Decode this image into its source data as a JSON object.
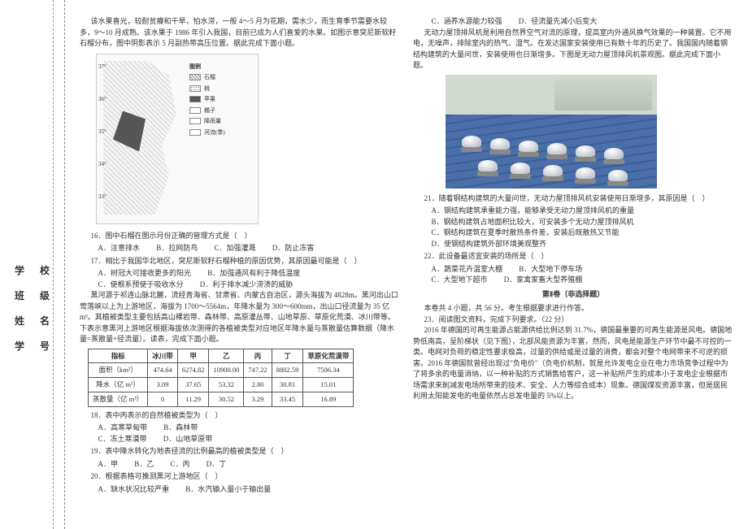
{
  "sidebar": {
    "labels": [
      "学 校",
      "班 级",
      "姓 名",
      "学 号"
    ]
  },
  "left": {
    "intro": "该水果喜光，较耐贫瘠和干旱，怕水涝，一般 4～5 月为花期，需水少，而生育季节需要水较多，9～10 月成熟。该水果于 1986 年引入我国，目前已成为人们喜爱的水果。如图示意突尼斯软籽石榴分布，图中阴影表示 5 月副热带高压位置。据此完成下面小题。",
    "map": {
      "lats": [
        "37°",
        "36°",
        "35°",
        "34°",
        "33°"
      ],
      "legend_title": "图例",
      "legend": [
        "石榴",
        "桃",
        "苹果",
        "橘子",
        "降雨量",
        "河流(季)"
      ]
    },
    "q16": {
      "stem": "16．图中石榴在图示月份正确的管理方式是（　）",
      "opts": [
        "A．注意排水",
        "B．拉网防鸟",
        "C．加强灌溉",
        "D．防止冻害"
      ]
    },
    "q17": {
      "stem": "17．相比于我国华北地区，突尼斯软籽石榴种植的原因优势，其原因最可能是（　）",
      "opts": [
        "A．树冠大可接收更多的阳光",
        "B．加强通风有利于降低温度",
        "C．使根系预使于吸收水分",
        "D．利于排水减少涝渍的威胁"
      ]
    },
    "context2": "黑河源于祁连山脉北麓，流经青海省、甘肃省、内蒙古自治区，源头海拔为 4828m。黑河出山口莺落峡以上为上游地区，海拔为 1700～5564m，年降水量为 300～600mm，出山口径流量为 35 亿 m³。其植被类型主要包括高山裸岩带、森林带、高原灌丛带、山地草原、草原化荒漠、冰川带等。下表示意黑河上游地区根据海拔依次测得的各植被类型对应地区年降水量与蒸散量估算数据（降水量=蒸散量+径流量）。读表，完成下面小题。",
    "table": {
      "headers": [
        "指标",
        "冰川带",
        "甲",
        "乙",
        "丙",
        "丁",
        "草原化荒漠带"
      ],
      "rows": [
        [
          "面积（km²）",
          "474.64",
          "6274.82",
          "10900.00",
          "747.22",
          "8802.59",
          "7506.34"
        ],
        [
          "降水（亿 m³）",
          "3.09",
          "37.65",
          "53.32",
          "2.80",
          "30.81",
          "15.01"
        ],
        [
          "蒸散量（亿 m³）",
          "0",
          "11.29",
          "30.52",
          "3.29",
          "33.45",
          "16.89"
        ]
      ]
    },
    "q18": {
      "stem": "18．表中丙表示的自然植被类型为（　）",
      "opts": [
        "A．高寒草甸带",
        "B．森林带",
        "C．冻土寒漠带",
        "D．山地草原带"
      ]
    },
    "q19": {
      "stem": "19．表中降水转化为地表径流的比例最高的植被类型是（　）",
      "opts": [
        "A．甲",
        "B．乙",
        "C．丙",
        "D．丁"
      ]
    },
    "q20": {
      "stem": "20．根据表格可推测黑河上游地区（　）",
      "opts": [
        "A．缺水状况比较严重",
        "B．水汽输入量小于输出量"
      ]
    }
  },
  "right": {
    "q20_cont": [
      "C．涵养水源能力较强",
      "D．径流量先减小后变大"
    ],
    "intro": "无动力屋顶排风机是利用自然界空气对流的原理，提高室内外通风换气效果的一种装置。它不用电，无噪声，排除室内的热气、湿气。在发达国家安装使用已有数十年的历史了。我国国内随着钢结构建筑的大量问世，安装使用也日渐增多。下图是无动力屋顶排风机景观图。据此完成下面小题。",
    "q21": {
      "stem": "21．随着钢结构建筑的大量问世，无动力屋顶排风机安装使用日渐增多，其原因是（　）",
      "opts": [
        "A．钢结构建筑承重能力强，能够承受无动力屋顶排风机的重量",
        "B．钢结构建筑占地面积比较大，可安装多个无动力屋顶排风机",
        "C．钢结构建筑在夏季时散热条件差，安装后既散热又节能",
        "D．使钢结构建筑外部环境美观整齐"
      ]
    },
    "q22": {
      "stem": "22．此设备最适宜安装的场所是（　）",
      "opts": [
        "A．蔬菜花卉温室大棚",
        "B．大型地下停车场",
        "C．大型地下超市",
        "D．家禽家畜大型养殖棚"
      ]
    },
    "part2_title": "第Ⅱ卷（非选择题）",
    "part2_note": "本卷共 4 小题，共 56 分。考生根据要求进行作答。",
    "q23_head": "23．阅读图文资料，完成下列要求。（22 分）",
    "q23_body": "2016 年德国的可再生能源占能源供给比例达到 31.7%，德国最重要的可再生能源是风电。德国地势低南高，呈阶梯状（见下图），北部风能资源为丰富，然而，风电是能源生产环节中最不可控的一类。电网对负荷的稳定性要求极高，过量的供给或是过量的消费，都会对整个电网带来不可逆的损害。2016 年德国就曾经出现过\"负电价\"（负电价机制，就是允许发电企业在电力市场竞争过程中为了将多余的电量消纳，以一种补贴的方式销售给客户，这一补贴所产生的成本小于发电企业根据市场需求来削减发电场所带来的技术、安全、人力等综合成本）现象。德国煤炭资源丰富，但是居民利用太阳能发电的电量依然占总发电量的 5%以上。"
  }
}
